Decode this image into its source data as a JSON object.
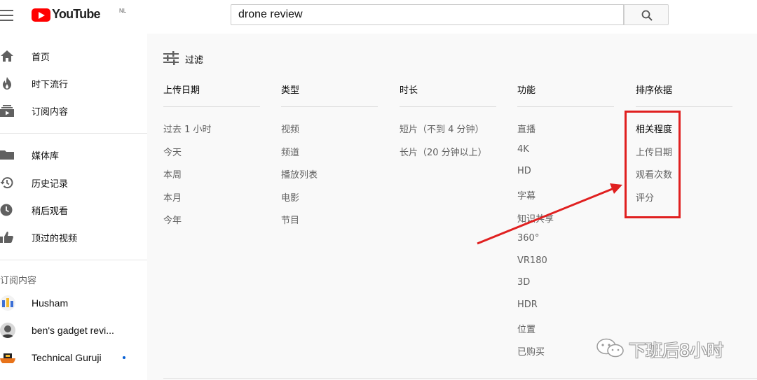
{
  "header": {
    "logo_text": "YouTube",
    "logo_region": "NL",
    "search_value": "drone review",
    "search_placeholder": "搜索"
  },
  "sidebar": {
    "items": [
      {
        "label": "首页",
        "icon": "home-icon"
      },
      {
        "label": "时下流行",
        "icon": "trending-icon"
      },
      {
        "label": "订阅内容",
        "icon": "subscriptions-icon"
      },
      {
        "label": "媒体库",
        "icon": "library-icon"
      },
      {
        "label": "历史记录",
        "icon": "history-icon"
      },
      {
        "label": "稍后观看",
        "icon": "watch-later-icon"
      },
      {
        "label": "顶过的视频",
        "icon": "liked-videos-icon"
      }
    ],
    "subscriptions_heading": "订阅内容",
    "subscriptions": [
      {
        "name": "Husham"
      },
      {
        "name": "ben's gadget revi..."
      },
      {
        "name": "Technical Guruji",
        "has_new": true
      }
    ]
  },
  "filter": {
    "title": "过滤",
    "columns": [
      {
        "title": "上传日期",
        "options": [
          "过去 1 小时",
          "今天",
          "本周",
          "本月",
          "今年"
        ]
      },
      {
        "title": "类型",
        "options": [
          "视频",
          "频道",
          "播放列表",
          "电影",
          "节目"
        ]
      },
      {
        "title": "时长",
        "options": [
          "短片（不到 4 分钟）",
          "长片（20 分钟以上）"
        ]
      },
      {
        "title": "功能",
        "options": [
          "直播",
          "4K",
          "HD",
          "字幕",
          "知识共享",
          "360°",
          "VR180",
          "3D",
          "HDR",
          "位置",
          "已购买"
        ]
      },
      {
        "title": "排序依据",
        "options": [
          "相关程度",
          "上传日期",
          "观看次数",
          "评分"
        ],
        "selected_index": 0
      }
    ]
  },
  "annotation": {
    "color": "#e02020"
  },
  "watermark": {
    "text": "下班后8小时"
  },
  "colors": {
    "brand": "#ff0000",
    "accent": "#065fd4",
    "annotation": "#e02020"
  }
}
